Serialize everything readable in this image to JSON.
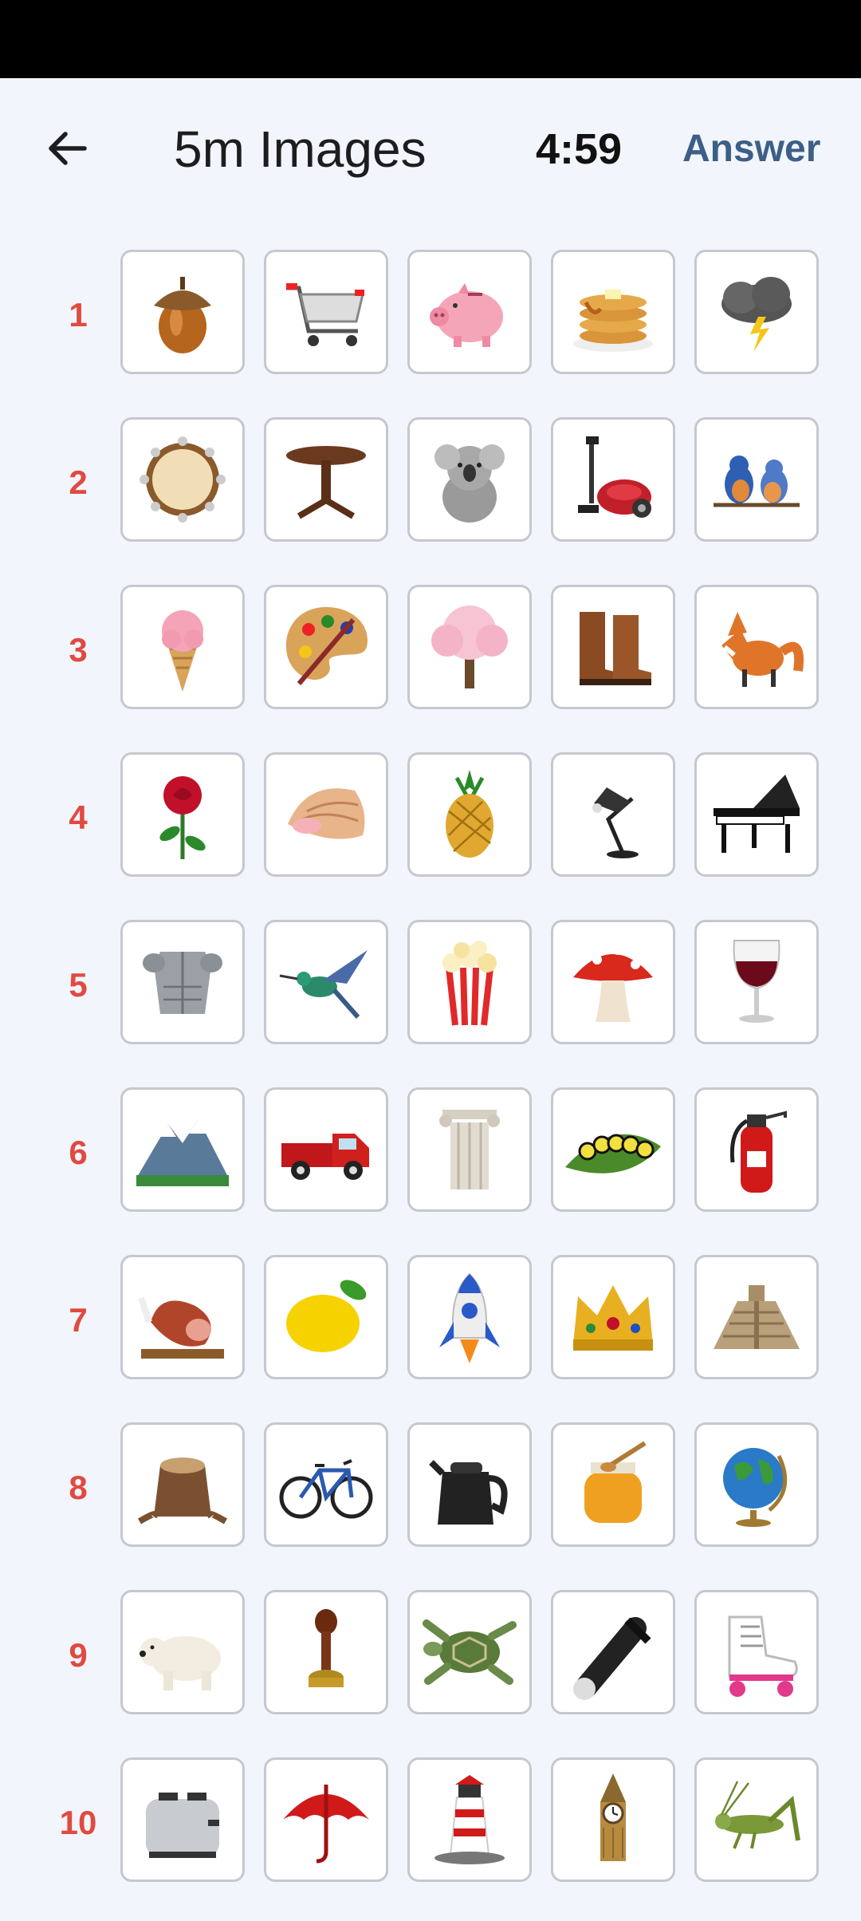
{
  "header": {
    "back_icon": "arrow-left-icon",
    "title": "5m Images",
    "timer": "4:59",
    "answer_label": "Answer"
  },
  "colors": {
    "accent": "#3b5f86",
    "row_number": "#e04a40",
    "background": "#f2f5fb"
  },
  "rows": [
    {
      "label": "1",
      "items": [
        "acorn-icon",
        "shopping-cart-icon",
        "piggy-bank-icon",
        "pancakes-icon",
        "storm-cloud-icon"
      ]
    },
    {
      "label": "2",
      "items": [
        "tambourine-icon",
        "round-table-icon",
        "koala-icon",
        "vacuum-cleaner-icon",
        "bluebirds-icon"
      ]
    },
    {
      "label": "3",
      "items": [
        "ice-cream-cone-icon",
        "paint-palette-icon",
        "cherry-blossom-tree-icon",
        "boots-icon",
        "fox-icon"
      ]
    },
    {
      "label": "4",
      "items": [
        "rose-icon",
        "seashell-icon",
        "pineapple-icon",
        "desk-lamp-icon",
        "grand-piano-icon"
      ]
    },
    {
      "label": "5",
      "items": [
        "armor-icon",
        "hummingbird-icon",
        "popcorn-icon",
        "mushroom-icon",
        "wine-glass-icon"
      ]
    },
    {
      "label": "6",
      "items": [
        "mountain-icon",
        "pickup-truck-icon",
        "column-icon",
        "caterpillar-icon",
        "fire-extinguisher-icon"
      ]
    },
    {
      "label": "7",
      "items": [
        "ham-icon",
        "lemon-icon",
        "rocket-icon",
        "crown-icon",
        "pyramid-icon"
      ]
    },
    {
      "label": "8",
      "items": [
        "tree-stump-icon",
        "bicycle-icon",
        "kettle-icon",
        "honey-jar-icon",
        "globe-icon"
      ]
    },
    {
      "label": "9",
      "items": [
        "polar-bear-icon",
        "wax-seal-stamp-icon",
        "sea-turtle-icon",
        "flashlight-icon",
        "roller-skate-icon"
      ]
    },
    {
      "label": "10",
      "items": [
        "toaster-icon",
        "umbrella-icon",
        "lighthouse-icon",
        "big-ben-icon",
        "grasshopper-icon"
      ]
    }
  ]
}
